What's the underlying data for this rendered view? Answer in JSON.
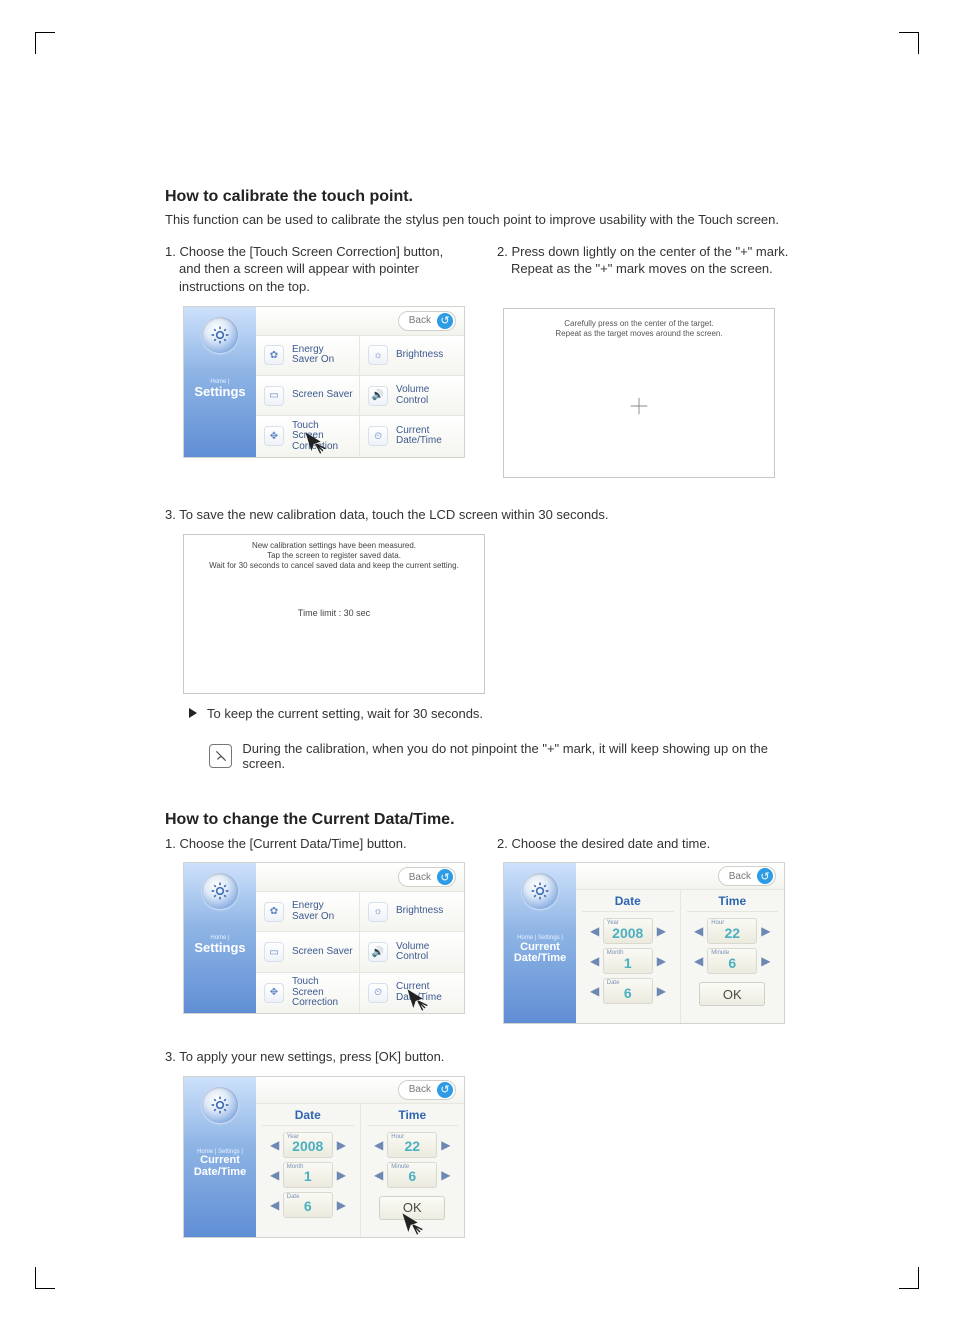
{
  "section1": {
    "heading": "How to calibrate the touch point.",
    "lead": "This function can be used to calibrate the stylus pen touch point to improve usability with the Touch screen.",
    "step1": "1. Choose the [Touch Screen Correction] button, and then a screen will appear with pointer instructions on the top.",
    "step2": "2. Press down lightly on the center of the \"+\" mark. Repeat as the \"+\" mark moves on the screen.",
    "step3": "3. To save the new calibration data, touch the LCD screen within 30 seconds.",
    "bullet_note": "To keep the current setting, wait for 30 seconds.",
    "info_note": "During the calibration, when you do not pinpoint the \"+\" mark, it will keep showing up on the screen."
  },
  "settings_panel": {
    "sidebar": {
      "crumb": "Home |",
      "title": "Settings"
    },
    "back": "Back",
    "tiles": [
      {
        "line1": "Energy",
        "line2": "Saver On"
      },
      {
        "line1": "Brightness",
        "line2": ""
      },
      {
        "line1": "Screen Saver",
        "line2": ""
      },
      {
        "line1": "Volume",
        "line2": "Control"
      },
      {
        "line1": "Touch Screen",
        "line2": "Correction"
      },
      {
        "line1": "Current",
        "line2": "Date/Time"
      }
    ]
  },
  "calib_box": {
    "line1": "Carefully press on the center of the target.",
    "line2": "Repeat as the target moves around the screen."
  },
  "save_box": {
    "line1": "New calibration settings have been measured.",
    "line2": "Tap the screen to register saved data.",
    "line3": "Wait for 30 seconds to cancel saved data and keep the current setting.",
    "time_limit": "Time limit : 30 sec"
  },
  "section2": {
    "heading": "How to change the Current Data/Time.",
    "step1": "1. Choose the [Current Data/Time] button.",
    "step2": "2. Choose the desired date and time.",
    "step3": "3. To apply your new settings, press [OK] button."
  },
  "datetime_panel": {
    "sidebar": {
      "crumb": "Home | Settings |",
      "title1": "Current",
      "title2": "Date/Time"
    },
    "back": "Back",
    "date_heading": "Date",
    "time_heading": "Time",
    "fields": {
      "year": {
        "label": "Year",
        "value": "2008"
      },
      "month": {
        "label": "Month",
        "value": "1"
      },
      "date": {
        "label": "Date",
        "value": "6"
      },
      "hour": {
        "label": "Hour",
        "value": "22"
      },
      "minute": {
        "label": "Minute",
        "value": "6"
      },
      "ok": "OK"
    }
  }
}
